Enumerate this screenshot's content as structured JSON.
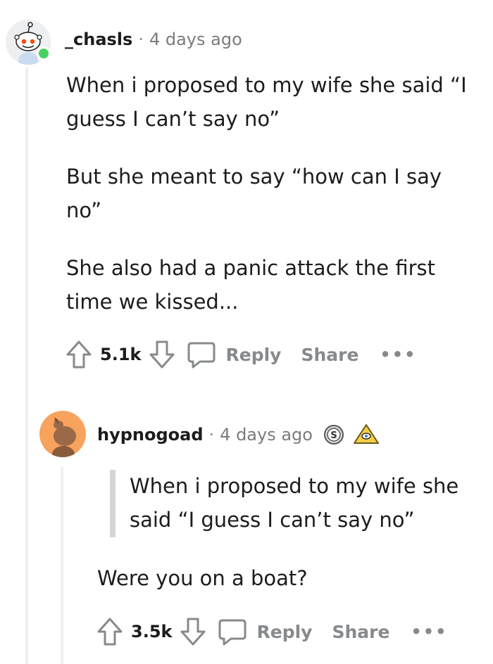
{
  "comments": [
    {
      "username": "_chasls",
      "separator": "·",
      "time": "4 days ago",
      "paragraphs": [
        "When i proposed to my wife she said “I guess I can’t say no”",
        "But she meant to say “how can I say no”",
        "She also had a panic attack the first time we kissed..."
      ],
      "score": "5.1k",
      "reply_label": "Reply",
      "share_label": "Share",
      "more_label": "•••"
    },
    {
      "username": "hypnogoad",
      "separator": "·",
      "time": "4 days ago",
      "quote": "When i proposed to my wife she said “I guess I can’t say no”",
      "body": "Were you on a boat?",
      "score": "3.5k",
      "reply_label": "Reply",
      "share_label": "Share",
      "more_label": "•••"
    }
  ],
  "colors": {
    "online": "#46d160",
    "avatar2_bg": "#f7a25d",
    "muted": "#878a8c"
  }
}
